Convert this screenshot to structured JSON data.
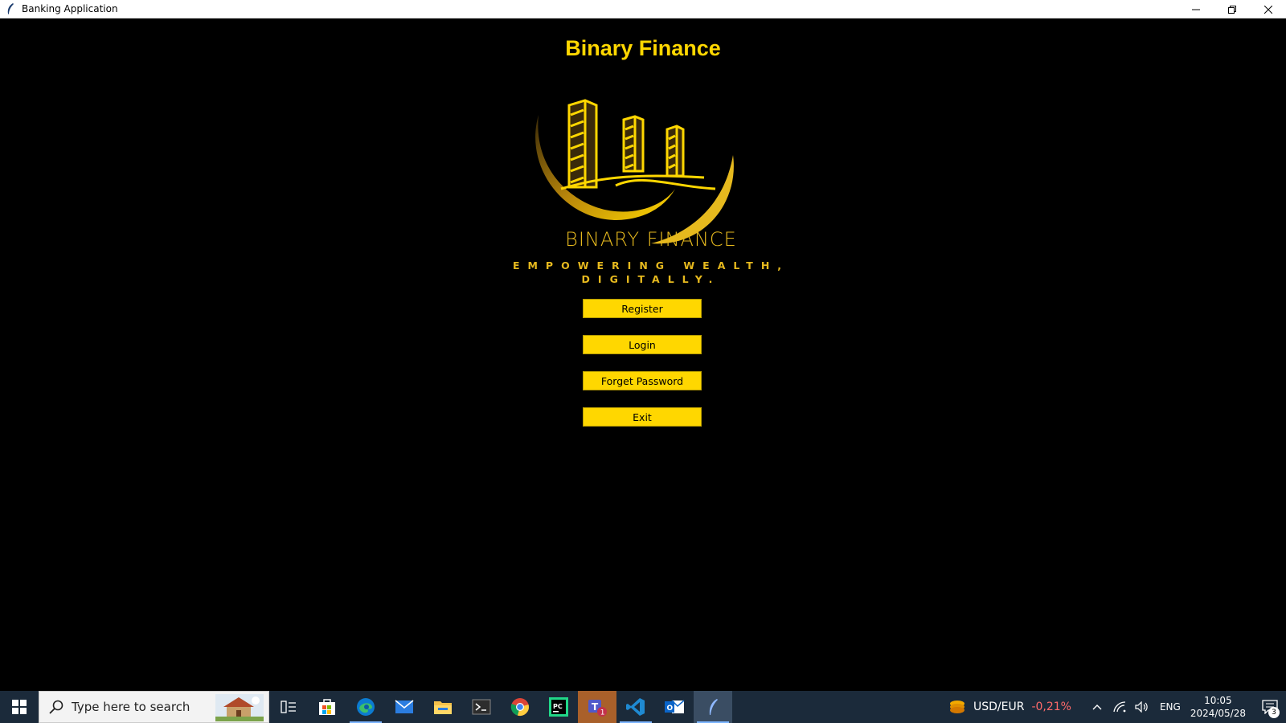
{
  "window": {
    "title": "Banking Application"
  },
  "app": {
    "heading": "Binary Finance",
    "brand_text": "BINARY FINANCE",
    "tagline_line1": "EMPOWERING WEALTH,",
    "tagline_line2": "DIGITALLY.",
    "accent_color": "#FFD700"
  },
  "buttons": {
    "register": "Register",
    "login": "Login",
    "forget_password": "Forget Password",
    "exit": "Exit"
  },
  "taskbar": {
    "search_placeholder": "Type here to search",
    "apps": [
      "task-view",
      "microsoft-store",
      "edge",
      "mail",
      "file-explorer",
      "terminal",
      "chrome",
      "pycharm",
      "teams",
      "vscode",
      "outlook",
      "python-feather"
    ],
    "teams_badge": "1",
    "tray": {
      "fx_label": "USD/EUR",
      "fx_change": "-0,21%",
      "language": "ENG",
      "time": "10:05",
      "date": "2024/05/28",
      "notification_count": "3"
    }
  }
}
